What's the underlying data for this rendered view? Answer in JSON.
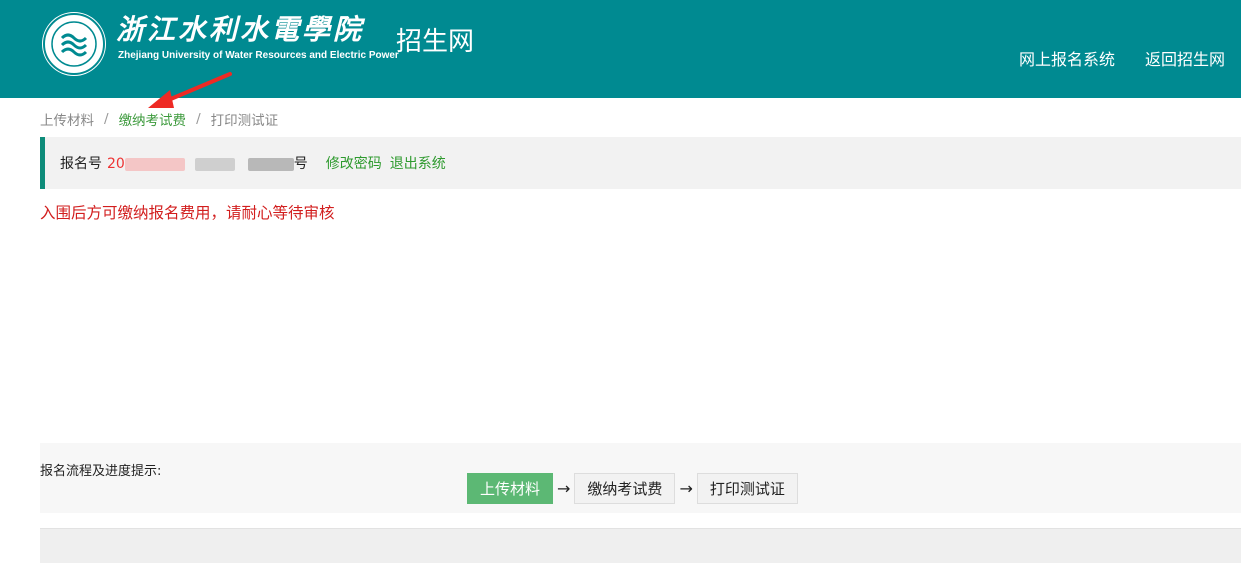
{
  "header": {
    "school_name_cn": "浙江水利水電學院",
    "school_name_en": "Zhejiang University of Water Resources and Electric Power",
    "site_title": "招生网",
    "nav": [
      {
        "label": "网上报名系统"
      },
      {
        "label": "返回招生网"
      }
    ],
    "colors": {
      "header_bg": "#008a91",
      "accent_green": "#3c9a3c",
      "alert_red": "#d21e1e"
    }
  },
  "breadcrumb": {
    "items": [
      {
        "label": "上传材料",
        "active": false
      },
      {
        "label": "缴纳考试费",
        "active": true
      },
      {
        "label": "打印测试证",
        "active": false
      }
    ],
    "separator": "/"
  },
  "info_bar": {
    "reg_label": "报名号",
    "reg_number_visible": "20",
    "reg_suffix": "号",
    "change_password": "修改密码",
    "logout": "退出系统"
  },
  "notice": "入围后方可缴纳报名费用，请耐心等待审核",
  "process": {
    "title": "报名流程及进度提示:",
    "steps": [
      {
        "label": "上传材料",
        "current": true
      },
      {
        "label": "缴纳考试费",
        "current": false
      },
      {
        "label": "打印测试证",
        "current": false
      }
    ],
    "arrow": "→"
  },
  "icons": {
    "logo": "school-seal-icon",
    "annotation": "red-arrow-icon"
  }
}
